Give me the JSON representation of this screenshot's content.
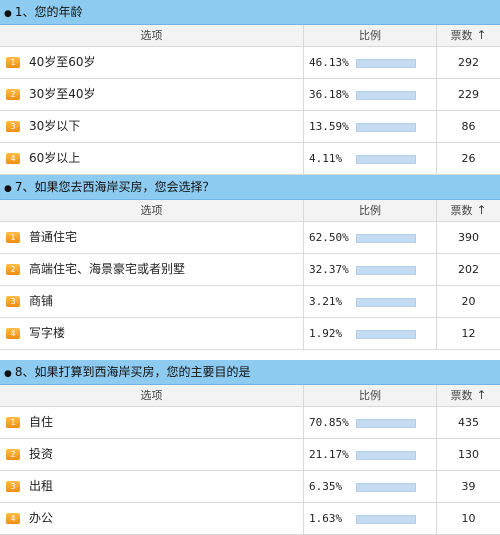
{
  "header_labels": {
    "option": "选项",
    "ratio": "比例",
    "votes": "票数",
    "sort_arrow": "↑"
  },
  "questions": [
    {
      "title": "1、您的年龄",
      "rows": [
        {
          "n": "1",
          "label": "40岁至60岁",
          "pct": "46.13%",
          "votes": "292"
        },
        {
          "n": "2",
          "label": "30岁至40岁",
          "pct": "36.18%",
          "votes": "229"
        },
        {
          "n": "3",
          "label": "30岁以下",
          "pct": "13.59%",
          "votes": "86"
        },
        {
          "n": "4",
          "label": "60岁以上",
          "pct": "4.11%",
          "votes": "26"
        }
      ]
    },
    {
      "title": "7、如果您去西海岸买房，您会选择？",
      "rows": [
        {
          "n": "1",
          "label": "普通住宅",
          "pct": "62.50%",
          "votes": "390"
        },
        {
          "n": "2",
          "label": "高端住宅、海景豪宅或者别墅",
          "pct": "32.37%",
          "votes": "202"
        },
        {
          "n": "3",
          "label": "商铺",
          "pct": "3.21%",
          "votes": "20"
        },
        {
          "n": "4",
          "label": "写字楼",
          "pct": "1.92%",
          "votes": "12"
        }
      ]
    },
    {
      "title": "8、如果打算到西海岸买房，您的主要目的是",
      "rows": [
        {
          "n": "1",
          "label": "自住",
          "pct": "70.85%",
          "votes": "435"
        },
        {
          "n": "2",
          "label": "投资",
          "pct": "21.17%",
          "votes": "130"
        },
        {
          "n": "3",
          "label": "出租",
          "pct": "6.35%",
          "votes": "39"
        },
        {
          "n": "4",
          "label": "办公",
          "pct": "1.63%",
          "votes": "10"
        }
      ]
    }
  ]
}
